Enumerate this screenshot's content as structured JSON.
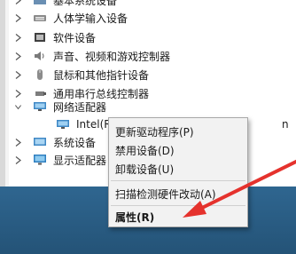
{
  "tree": {
    "items": [
      {
        "label": "基本系统设备",
        "state": "collapsed"
      },
      {
        "label": "人体学输入设备",
        "state": "collapsed"
      },
      {
        "label": "软件设备",
        "state": "collapsed"
      },
      {
        "label": "声音、视频和游戏控制器",
        "state": "collapsed"
      },
      {
        "label": "鼠标和其他指针设备",
        "state": "collapsed"
      },
      {
        "label": "通用串行总线控制器",
        "state": "collapsed"
      },
      {
        "label": "网络适配器",
        "state": "expanded"
      },
      {
        "label": "系统设备",
        "state": "collapsed"
      },
      {
        "label": "显示适配器",
        "state": "collapsed"
      }
    ],
    "network_child": {
      "label": "Intel(R)",
      "trailing_clipped": "n"
    }
  },
  "context_menu": {
    "items": [
      {
        "label": "更新驱动程序(P)",
        "bold": false
      },
      {
        "label": "禁用设备(D)",
        "bold": false
      },
      {
        "label": "卸载设备(U)",
        "bold": false
      },
      {
        "label": "扫描检测硬件改动(A)",
        "bold": false
      },
      {
        "label": "属性(R)",
        "bold": true
      }
    ]
  },
  "colors": {
    "menu_bg": "#f2f2f2",
    "annotation_arrow": "#e5322d",
    "taskbar": "#2c5f8a"
  },
  "icons": {
    "tree_expand": "chevron-right-icon",
    "tree_collapse": "chevron-down-icon",
    "device_keyboard": "keyboard-icon",
    "device_software": "software-device-icon",
    "device_audio": "speaker-icon",
    "device_mouse": "mouse-icon",
    "device_usb": "usb-icon",
    "device_network": "network-adapter-icon",
    "device_system": "system-device-icon",
    "device_display": "monitor-icon",
    "annotation": "red-arrow-annotation"
  }
}
